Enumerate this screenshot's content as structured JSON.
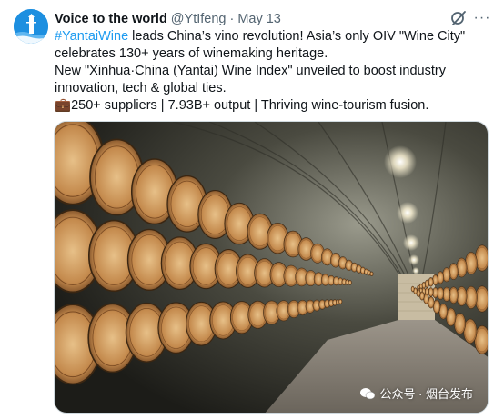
{
  "tweet": {
    "author_name": "Voice to the world",
    "handle": "@YtIfeng",
    "separator": "·",
    "date": "May 13",
    "more_label": "···",
    "hashtag": "#YantaiWine",
    "line1_rest": " leads China’s vino revolution! Asia’s only OIV \"Wine City\" celebrates 130+ years of winemaking heritage.",
    "line2": "New \"Xinhua·China (Yantai) Wine Index\" unveiled to boost industry innovation, tech & global ties.",
    "line3_emoji": "💼",
    "line3": "250+ suppliers | 7.93B+ output | Thriving wine-tourism fusion."
  },
  "media": {
    "description_icon": "wine-cellar-photo",
    "watermark_text": "公众号 · 烟台发布",
    "watermark_icon": "wechat-icon"
  },
  "icons": {
    "avatar": "avatar-lighthouse-icon",
    "grok": "grok-icon",
    "more": "more-icon"
  },
  "colors": {
    "link": "#1d9bf0",
    "secondary_text": "#536471",
    "avatar_bg": "#1d8fe0"
  }
}
